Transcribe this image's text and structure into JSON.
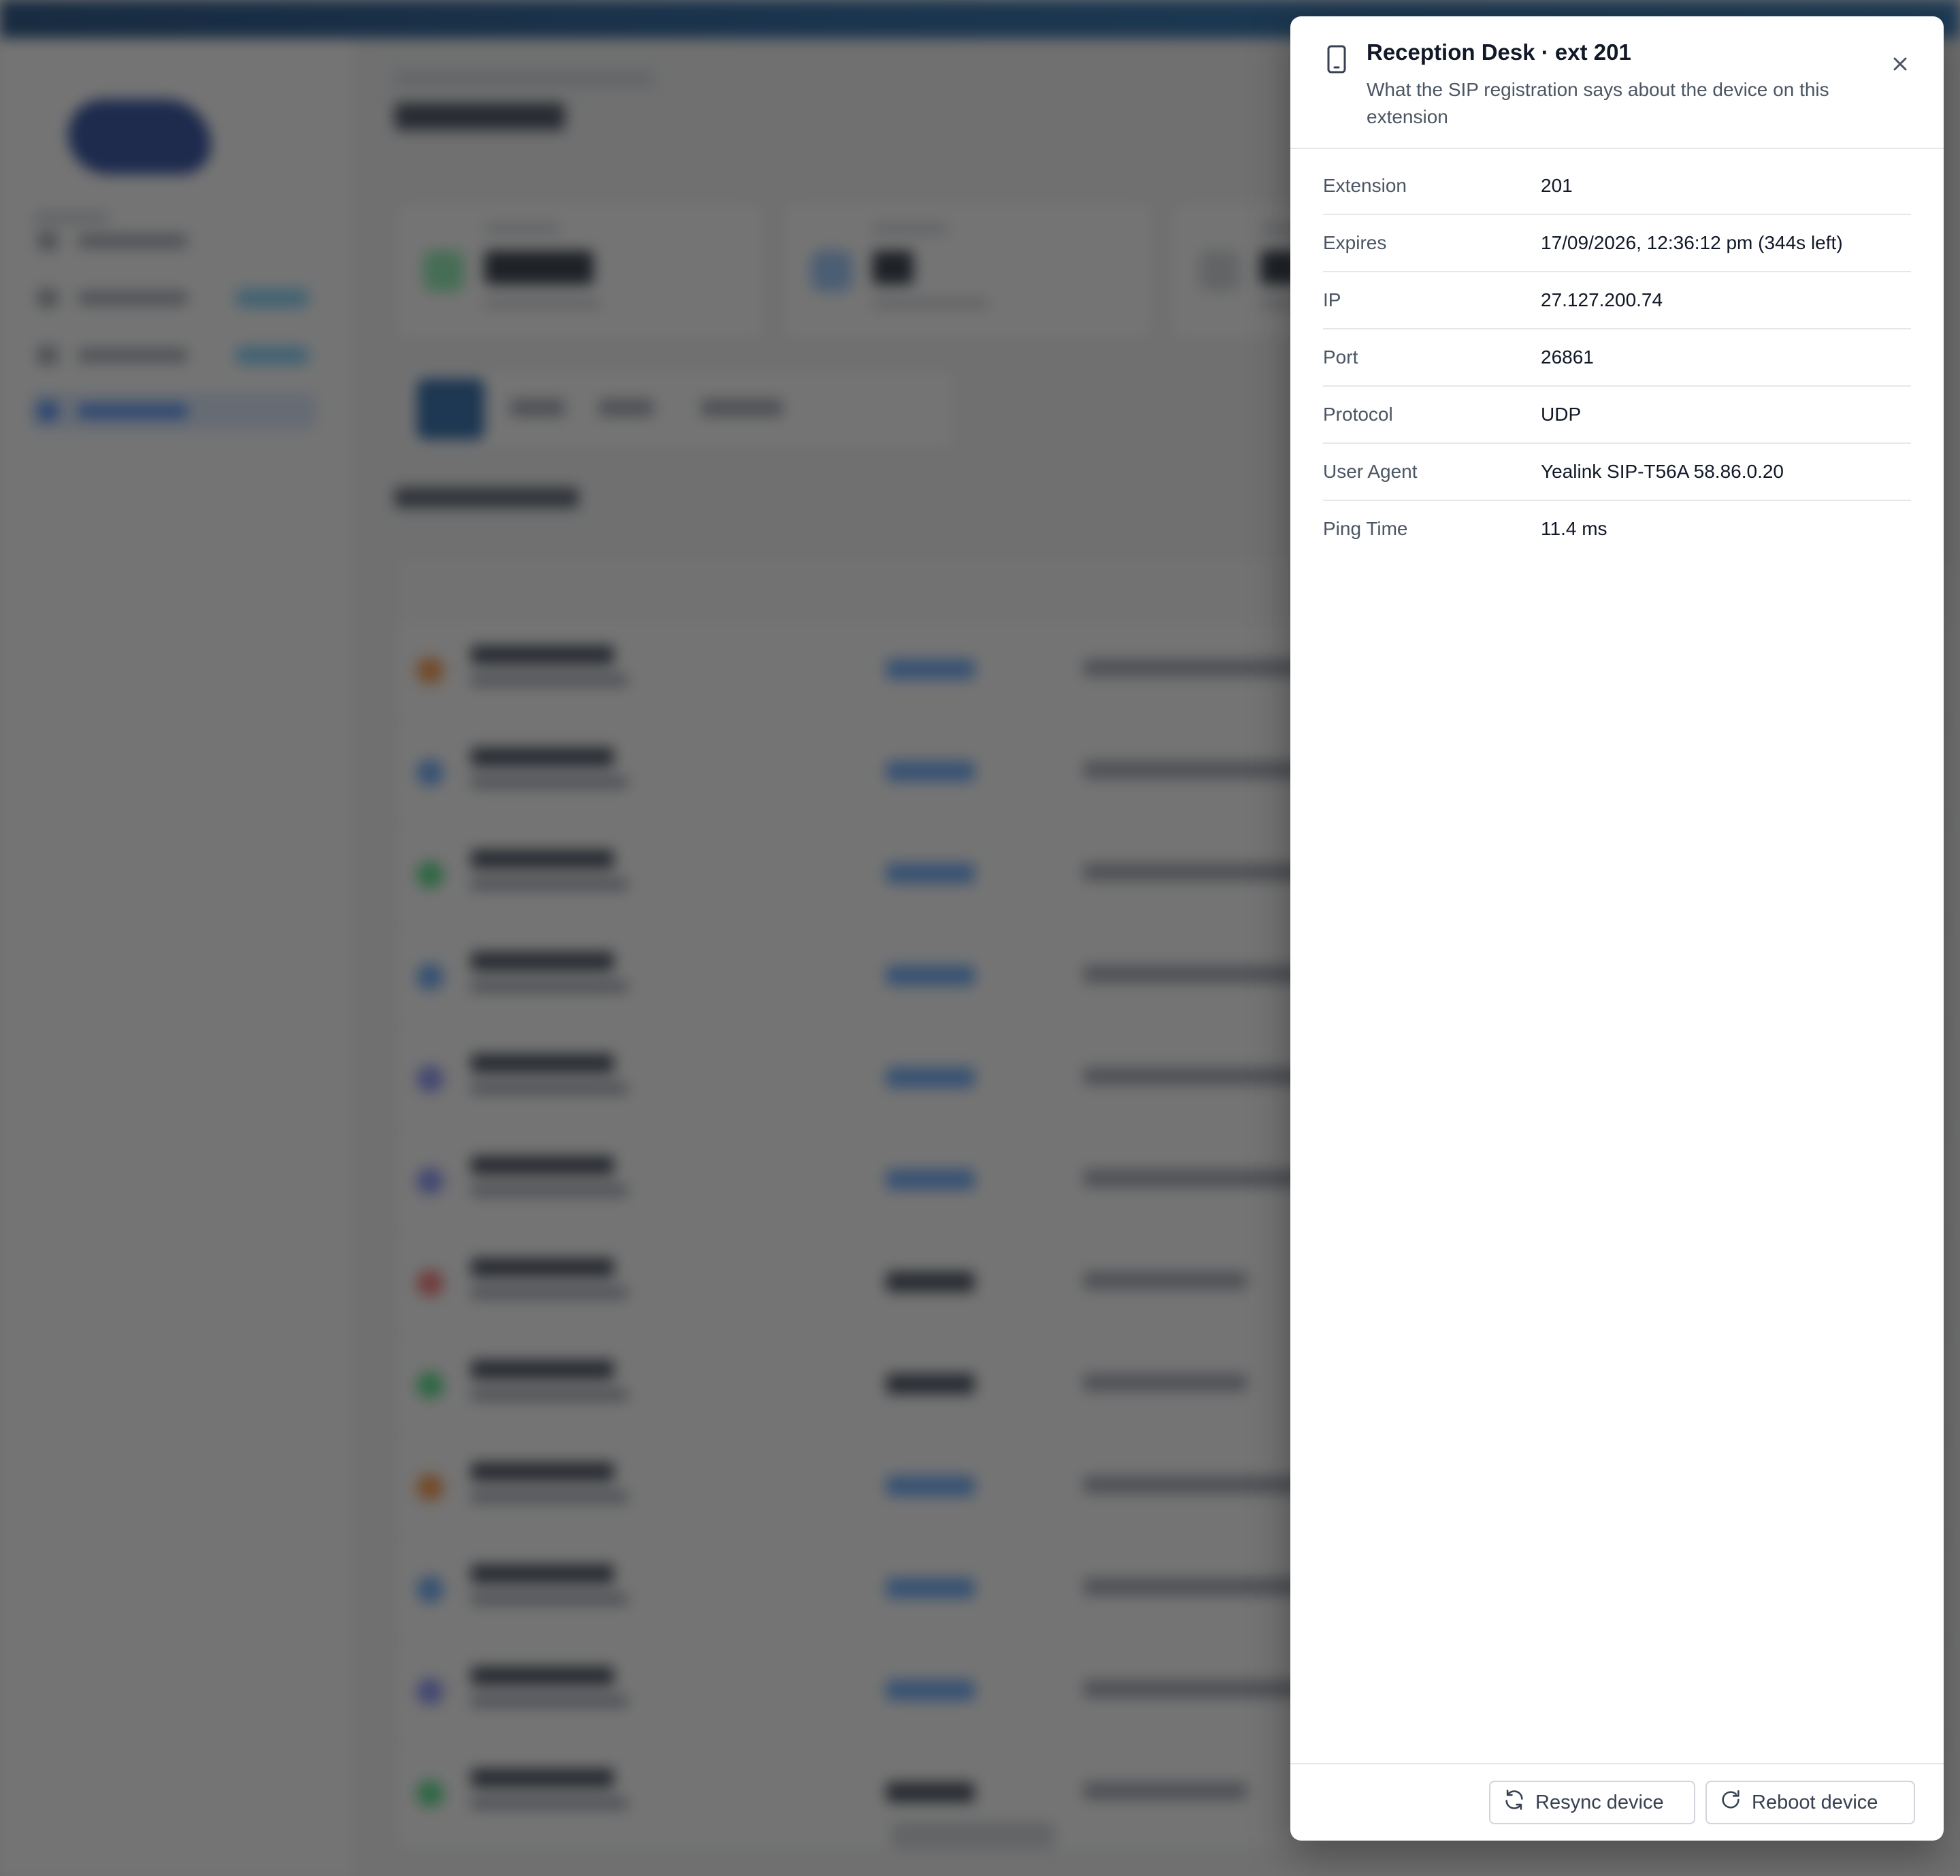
{
  "drawer": {
    "title": "Reception Desk · ext 201",
    "subtitle": "What the SIP registration says about the device on this extension",
    "details": [
      {
        "label": "Extension",
        "value": "201"
      },
      {
        "label": "Expires",
        "value": "17/09/2026, 12:36:12 pm (344s left)"
      },
      {
        "label": "IP",
        "value": "27.127.200.74"
      },
      {
        "label": "Port",
        "value": "26861"
      },
      {
        "label": "Protocol",
        "value": "UDP"
      },
      {
        "label": "User Agent",
        "value": "Yealink SIP-T56A 58.86.0.20"
      },
      {
        "label": "Ping Time",
        "value": "11.4 ms"
      }
    ],
    "actions": {
      "resync_label": "Resync device",
      "reboot_label": "Reboot device"
    },
    "icons": {
      "header": "mobile-device-icon",
      "close": "close-icon",
      "resync": "refresh-icon",
      "reboot": "restart-icon"
    }
  },
  "colors": {
    "overlay": "#1e1e1e",
    "topbar": "#0d3f78",
    "accent": "#1d5fa5"
  }
}
